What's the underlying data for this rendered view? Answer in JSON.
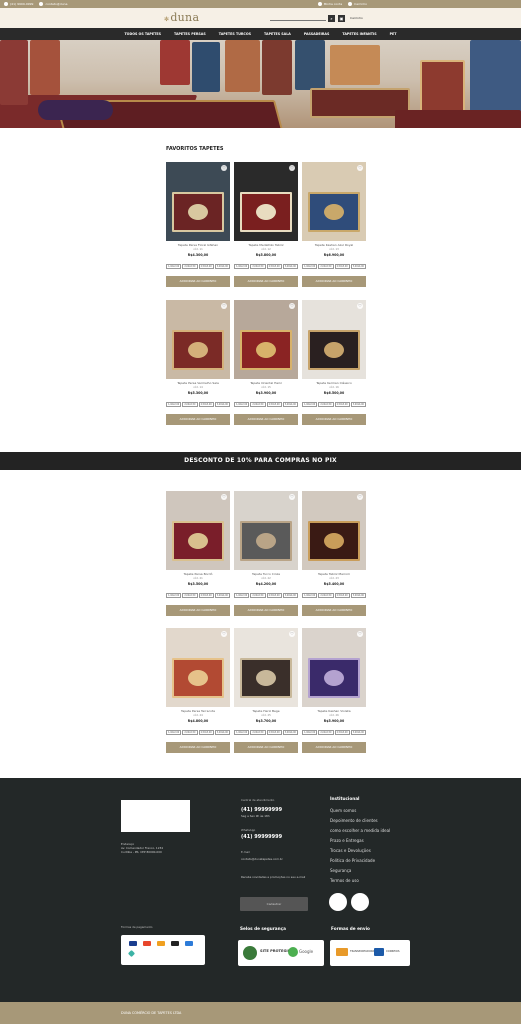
{
  "topbar": {
    "left": [
      "(41) 9999-9999",
      "contato@duna"
    ],
    "right": [
      "Minha conta",
      "Carrinho"
    ]
  },
  "header": {
    "logo_text": "duna",
    "search_placeholder": "",
    "cart_label": "Carrinho"
  },
  "nav": [
    "TODOS OS TAPETES",
    "TAPETES PERSAS",
    "TAPETES TURCOS",
    "TAPETES SALA",
    "PASSADEIRAS",
    "TAPETES INFANTIS",
    "PET"
  ],
  "section1": {
    "title": "FAVORITOS TAPETES",
    "cards": [
      {
        "name": "Tapete Persa Floral Isfahan",
        "code": "cód. 11",
        "price": "R$4.300,00",
        "button": "ADICIONAR AO CARRINHO"
      },
      {
        "name": "Tapete Medalhão Tabriz",
        "code": "cód. 12",
        "price": "R$5.800,00",
        "button": "ADICIONAR AO CARRINHO"
      },
      {
        "name": "Tapete Kashan Azul Royal",
        "code": "cód. 13",
        "price": "R$6.900,00",
        "button": "ADICIONAR AO CARRINHO"
      },
      {
        "name": "Tapete Persa Vermelho Sala",
        "code": "cód. 14",
        "price": "R$5.300,00",
        "button": "ADICIONAR AO CARRINHO"
      },
      {
        "name": "Tapete Oriental Heriz",
        "code": "cód. 15",
        "price": "R$3.900,00",
        "button": "ADICIONAR AO CARRINHO"
      },
      {
        "name": "Tapete Kerman Clássico",
        "code": "cód. 16",
        "price": "R$6.500,00",
        "button": "ADICIONAR AO CARRINHO"
      }
    ],
    "sizes": [
      "1,40x2,00",
      "2,00x2,50",
      "2,50x3,00",
      "3,00x4,00"
    ]
  },
  "promo": "DESCONTO DE 10% PARA COMPRAS NO PIX",
  "section2": {
    "cards": [
      {
        "name": "Tapete Persa Bordô",
        "code": "cód. 21",
        "price": "R$3.500,00",
        "button": "ADICIONAR AO CARRINHO"
      },
      {
        "name": "Tapete Turco Cinza",
        "code": "cód. 22",
        "price": "R$4.200,00",
        "button": "ADICIONAR AO CARRINHO"
      },
      {
        "name": "Tapete Tabriz Marrom",
        "code": "cód. 23",
        "price": "R$5.400,00",
        "button": "ADICIONAR AO CARRINHO"
      },
      {
        "name": "Tapete Persa Terracota",
        "code": "cód. 24",
        "price": "R$4.800,00",
        "button": "ADICIONAR AO CARRINHO"
      },
      {
        "name": "Tapete Heriz Bege",
        "code": "cód. 25",
        "price": "R$3.700,00",
        "button": "ADICIONAR AO CARRINHO"
      },
      {
        "name": "Tapete Kashan Violeta",
        "code": "cód. 26",
        "price": "R$5.900,00",
        "button": "ADICIONAR AO CARRINHO"
      }
    ]
  },
  "footer": {
    "address": [
      "Endereço",
      "Av. Comendador Franco, 1234",
      "Curitiba - PR, CEP 80000-000"
    ],
    "contact_label": "Central de atendimento",
    "phone1": "(41) 99999999",
    "phone1_sub": "Seg a Sex 9h às 18h",
    "whatsapp_label": "WhatsApp",
    "phone2": "(41) 99999999",
    "email_label": "E-mail",
    "email": "contato@dunatapetes.com.br",
    "newsletter_label": "Receba novidades e promoções no seu e-mail",
    "newsletter_button": "Cadastrar",
    "institutional_title": "Institucional",
    "links": [
      "Quem somos",
      "Depoimento de clientes",
      "como escolher a medida ideal",
      "Prazo e Entregas",
      "Trocas e Devoluções",
      "Política de Privacidade",
      "Segurança",
      "Termos de uso"
    ],
    "payment_title": "Formas de pagamento",
    "security_title": "Selos de segurança",
    "shipping_title": "Formas de envio",
    "security_seal1": "SITE PROTEGIDO",
    "security_seal2": "Google",
    "shipping1": "TRANSPORTADORA",
    "shipping2": "CORREIOS"
  },
  "bottom": "DUNA COMÉRCIO DE TAPETES LTDA"
}
